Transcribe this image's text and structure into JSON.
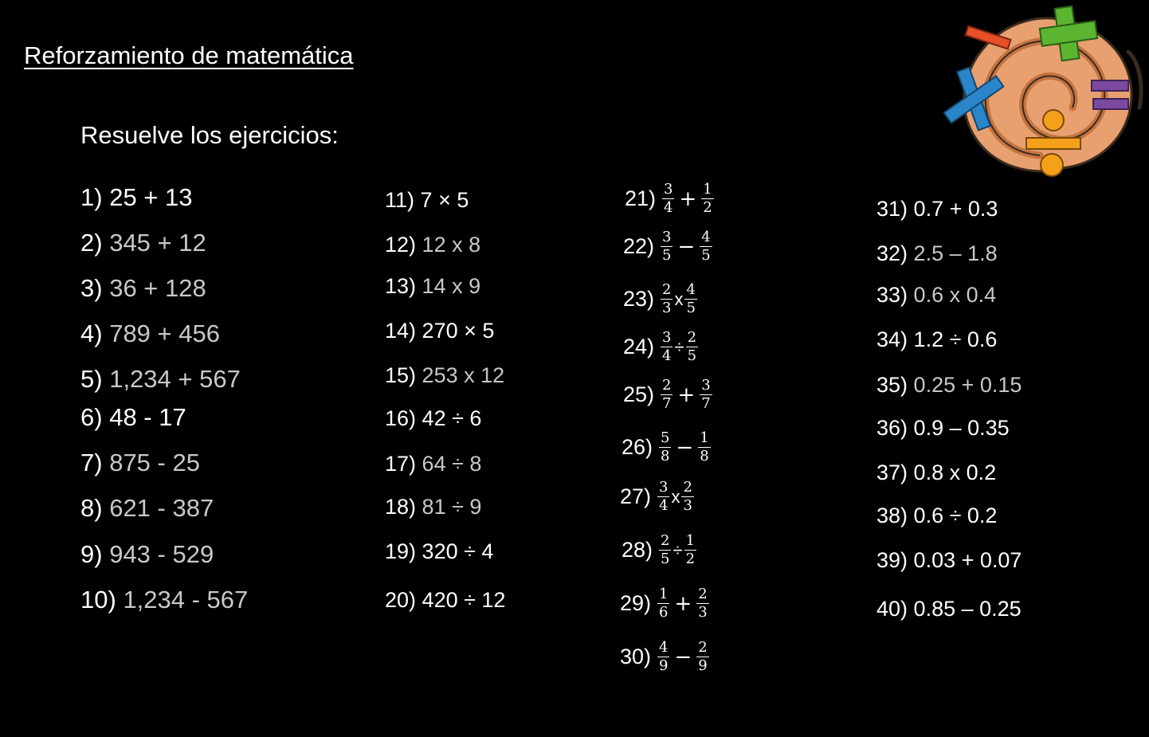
{
  "title": "Reforzamiento de matemática",
  "subtitle": "Resuelve los ejercicios:",
  "column1": [
    {
      "num": "1)",
      "expr": "25 + 13"
    },
    {
      "num": "2)",
      "expr": "345 + 12"
    },
    {
      "num": "3)",
      "expr": "36 + 128"
    },
    {
      "num": "4)",
      "expr": "789 + 456"
    },
    {
      "num": "5)",
      "expr": "1,234 + 567"
    },
    {
      "num": "6)",
      "expr": "48 - 17"
    },
    {
      "num": "7)",
      "expr": "875 - 25"
    },
    {
      "num": "8)",
      "expr": "621 - 387"
    },
    {
      "num": "9)",
      "expr": "943 - 529"
    },
    {
      "num": "10)",
      "expr": "1,234 - 567"
    }
  ],
  "column2": [
    {
      "num": "11)",
      "expr": "7 × 5"
    },
    {
      "num": "12)",
      "expr": "12 x 8"
    },
    {
      "num": "13)",
      "expr": "14 x 9"
    },
    {
      "num": "14)",
      "expr": "270 × 5"
    },
    {
      "num": "15)",
      "expr": "253 x 12"
    },
    {
      "num": "16)",
      "expr": "42 ÷ 6"
    },
    {
      "num": "17)",
      "expr": "64 ÷ 8"
    },
    {
      "num": "18)",
      "expr": "81 ÷ 9"
    },
    {
      "num": "19)",
      "expr": "320 ÷ 4"
    },
    {
      "num": "20)",
      "expr": "420 ÷ 12"
    }
  ],
  "column3": [
    {
      "num": "21)",
      "a_num": "3",
      "a_den": "4",
      "op": "+",
      "b_num": "1",
      "b_den": "2"
    },
    {
      "num": "22)",
      "a_num": "3",
      "a_den": "5",
      "op": "−",
      "b_num": "4",
      "b_den": "5"
    },
    {
      "num": "23)",
      "a_num": "2",
      "a_den": "3",
      "op": "x",
      "b_num": "4",
      "b_den": "5"
    },
    {
      "num": "24)",
      "a_num": "3",
      "a_den": "4",
      "op": "÷",
      "b_num": "2",
      "b_den": "5"
    },
    {
      "num": "25)",
      "a_num": "2",
      "a_den": "7",
      "op": "+",
      "b_num": "3",
      "b_den": "7"
    },
    {
      "num": "26)",
      "a_num": "5",
      "a_den": "8",
      "op": "−",
      "b_num": "1",
      "b_den": "8"
    },
    {
      "num": "27)",
      "a_num": "3",
      "a_den": "4",
      "op": "x",
      "b_num": "2",
      "b_den": "3"
    },
    {
      "num": "28)",
      "a_num": "2",
      "a_den": "5",
      "op": "÷",
      "b_num": "1",
      "b_den": "2"
    },
    {
      "num": "29)",
      "a_num": "1",
      "a_den": "6",
      "op": "+",
      "b_num": "2",
      "b_den": "3"
    },
    {
      "num": "30)",
      "a_num": "4",
      "a_den": "9",
      "op": "−",
      "b_num": "2",
      "b_den": "9"
    }
  ],
  "column4": [
    {
      "num": "31)",
      "expr": "0.7 + 0.3"
    },
    {
      "num": "32)",
      "expr": "2.5 – 1.8"
    },
    {
      "num": "33)",
      "expr": "0.6 x 0.4"
    },
    {
      "num": "34)",
      "expr": "1.2 ÷ 0.6"
    },
    {
      "num": "35)",
      "expr": "0.25 + 0.15"
    },
    {
      "num": "36)",
      "expr": "0.9 – 0.35"
    },
    {
      "num": "37)",
      "expr": "0.8 x 0.2"
    },
    {
      "num": "38)",
      "expr": "0.6 ÷ 0.2"
    },
    {
      "num": "39)",
      "expr": "0.03 + 0.07"
    },
    {
      "num": "40)",
      "expr": "0.85 – 0.25"
    }
  ],
  "logo": {
    "name": "math-operations-spiral-logo",
    "colors": {
      "spiral": "#e8a070",
      "outline": "#3a2a20",
      "plus": "#5cb531",
      "minus": "#e8502a",
      "times": "#2a86c9",
      "equals": "#7b4aa0",
      "divide": "#f5a01a"
    }
  }
}
